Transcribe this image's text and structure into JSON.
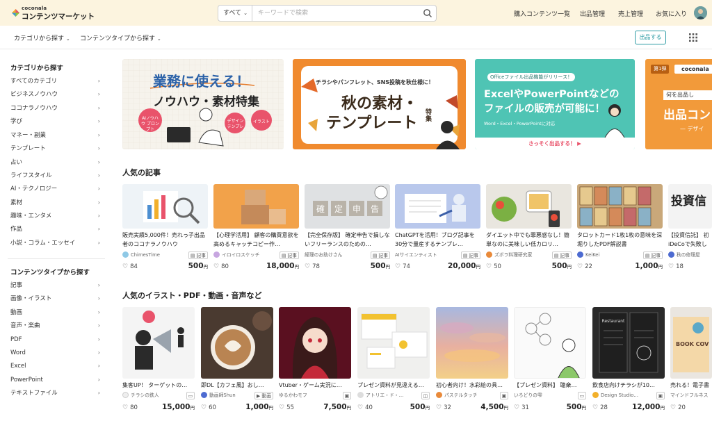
{
  "header": {
    "logo_small": "coconala",
    "logo_big": "コンテンツマーケット",
    "search_category": "すべて",
    "search_placeholder": "キーワードで検索",
    "nav": [
      "購入コンテンツ一覧",
      "出品管理",
      "売上管理",
      "お気に入り"
    ]
  },
  "subheader": {
    "links": [
      "カテゴリから探す",
      "コンテンツタイプから探す"
    ],
    "sell_button": "出品する"
  },
  "sidebar": {
    "category_heading": "カテゴリから探す",
    "categories": [
      "すべてのカテゴリ",
      "ビジネスノウハウ",
      "ココナラノウハウ",
      "学び",
      "マネー・副業",
      "テンプレート",
      "占い",
      "ライフスタイル",
      "AI・テクノロジー",
      "素材",
      "趣味・エンタメ",
      "作品",
      "小説・コラム・エッセイ"
    ],
    "type_heading": "コンテンツタイプから探す",
    "types": [
      "記事",
      "画像・イラスト",
      "動画",
      "音声・楽曲",
      "PDF",
      "Word",
      "Excel",
      "PowerPoint",
      "テキストファイル"
    ]
  },
  "banners": [
    {
      "line1": "業務に使える！",
      "line2": "ノウハウ・素材特集",
      "tag1": "AIノウハウ プロンプト",
      "tag2": "デザイン テンプレ",
      "tag3": "イラスト"
    },
    {
      "line1": "チラシやパンフレット、SNS投稿を秋仕様に！",
      "line2": "秋の素材・",
      "line3": "テンプレート",
      "tag": "特集"
    },
    {
      "line1": "Officeファイル出品機能がリリース！",
      "line2": "ExcelやPowerPointなどの",
      "line3": "ファイルの販売が可能に！",
      "line4": "Word・Excel・PowerPointに対応",
      "cta": "さっそく出品する！ ▶"
    },
    {
      "badge": "第1弾",
      "logo": "coconala",
      "line1": "何を出品し",
      "line2": "出品コン",
      "line3": "— デザイ"
    }
  ],
  "articles_section": {
    "title": "人気の記事",
    "items": [
      {
        "title": "販売実績5,000件！売れっ子出品者のココナラノウハウ",
        "author": "ChimesTime",
        "type": "記事",
        "likes": "84",
        "price": "500",
        "unit": "円"
      },
      {
        "title": "【心理学活用】 顧客の購買意欲を高めるキャッチコピー作…",
        "author": "イロイロスケッチ",
        "type": "記事",
        "likes": "80",
        "price": "18,000",
        "unit": "円"
      },
      {
        "title": "【完全保存版】 確定申告で損しないフリーランスのための…",
        "author": "経理のお助けさん",
        "type": "記事",
        "likes": "78",
        "price": "500",
        "unit": "円"
      },
      {
        "title": "ChatGPTを活用！ブログ記事を30分で量産するテンプレ…",
        "author": "AIサイエンティスト",
        "type": "記事",
        "likes": "74",
        "price": "20,000",
        "unit": "円"
      },
      {
        "title": "ダイエット中でも罪悪感なし！簡単なのに美味しい低カロリ…",
        "author": "ズボラ料理研究家",
        "type": "記事",
        "likes": "50",
        "price": "500",
        "unit": "円"
      },
      {
        "title": "タロットカード1枚1枚の意味を深堀りしたPDF解説書",
        "author": "KeiKei",
        "type": "記事",
        "likes": "22",
        "price": "1,000",
        "unit": "円"
      },
      {
        "title": "【投資信託】 初 iDeCoで失敗し",
        "author": "秋の修理屋",
        "type": "記事",
        "likes": "18",
        "price": "",
        "unit": ""
      }
    ]
  },
  "media_section": {
    "title": "人気のイラスト・PDF・動画・音声など",
    "items": [
      {
        "title": "集客UP！ ターゲットの…",
        "author": "チラシの鉄人",
        "type": "",
        "likes": "80",
        "price": "15,000",
        "unit": "円"
      },
      {
        "title": "即DL【カフェ風】おし…",
        "author": "動画師Shun",
        "type": "動画",
        "likes": "60",
        "price": "1,000",
        "unit": "円"
      },
      {
        "title": "Vtuber・ゲーム実況に…",
        "author": "ゆるかわモフ",
        "type": "",
        "likes": "55",
        "price": "7,500",
        "unit": "円"
      },
      {
        "title": "プレゼン資料が見違える…",
        "author": "アトリエ・ド・…",
        "type": "",
        "likes": "40",
        "price": "500",
        "unit": "円"
      },
      {
        "title": "初心者向け！水彩絵の具…",
        "author": "パステルタッチ",
        "type": "",
        "likes": "32",
        "price": "4,500",
        "unit": "円"
      },
      {
        "title": "【プレゼン資料】 聴衆…",
        "author": "いろどりの雫",
        "type": "",
        "likes": "31",
        "price": "500",
        "unit": "円"
      },
      {
        "title": "飲食店向けチラシが10…",
        "author": "Design Studio…",
        "type": "",
        "likes": "28",
        "price": "12,000",
        "unit": "円"
      },
      {
        "title": "売れる！電子書",
        "author": "マインドフルネス",
        "type": "",
        "likes": "20",
        "price": "",
        "unit": ""
      }
    ]
  },
  "colors": {
    "header_bg": "#fcf4df",
    "accent": "#2a9aa3",
    "banner_orange": "#f08a2e",
    "banner_teal": "#4fc4b4"
  }
}
